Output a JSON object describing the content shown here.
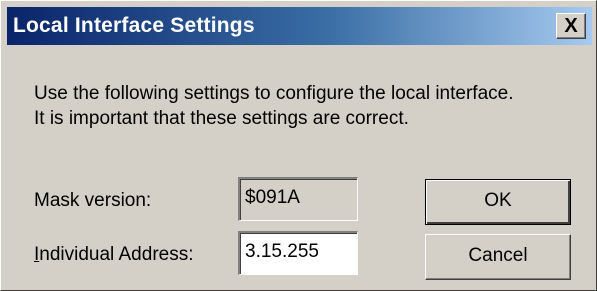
{
  "window": {
    "title": "Local Interface Settings",
    "close_glyph": "X"
  },
  "description": {
    "line1": "Use the following settings to configure the local interface.",
    "line2": "It is important that these settings are correct."
  },
  "mask_version": {
    "label": "Mask version:",
    "value": "$091A"
  },
  "individual_address": {
    "label_mnemonic": "I",
    "label_rest": "ndividual Address:",
    "value": "3.15.255"
  },
  "buttons": {
    "ok_label": "OK",
    "cancel_label": "Cancel"
  },
  "colors": {
    "title_start": "#0a246a",
    "title_end": "#a6caf0",
    "face": "#d4d0c8"
  }
}
